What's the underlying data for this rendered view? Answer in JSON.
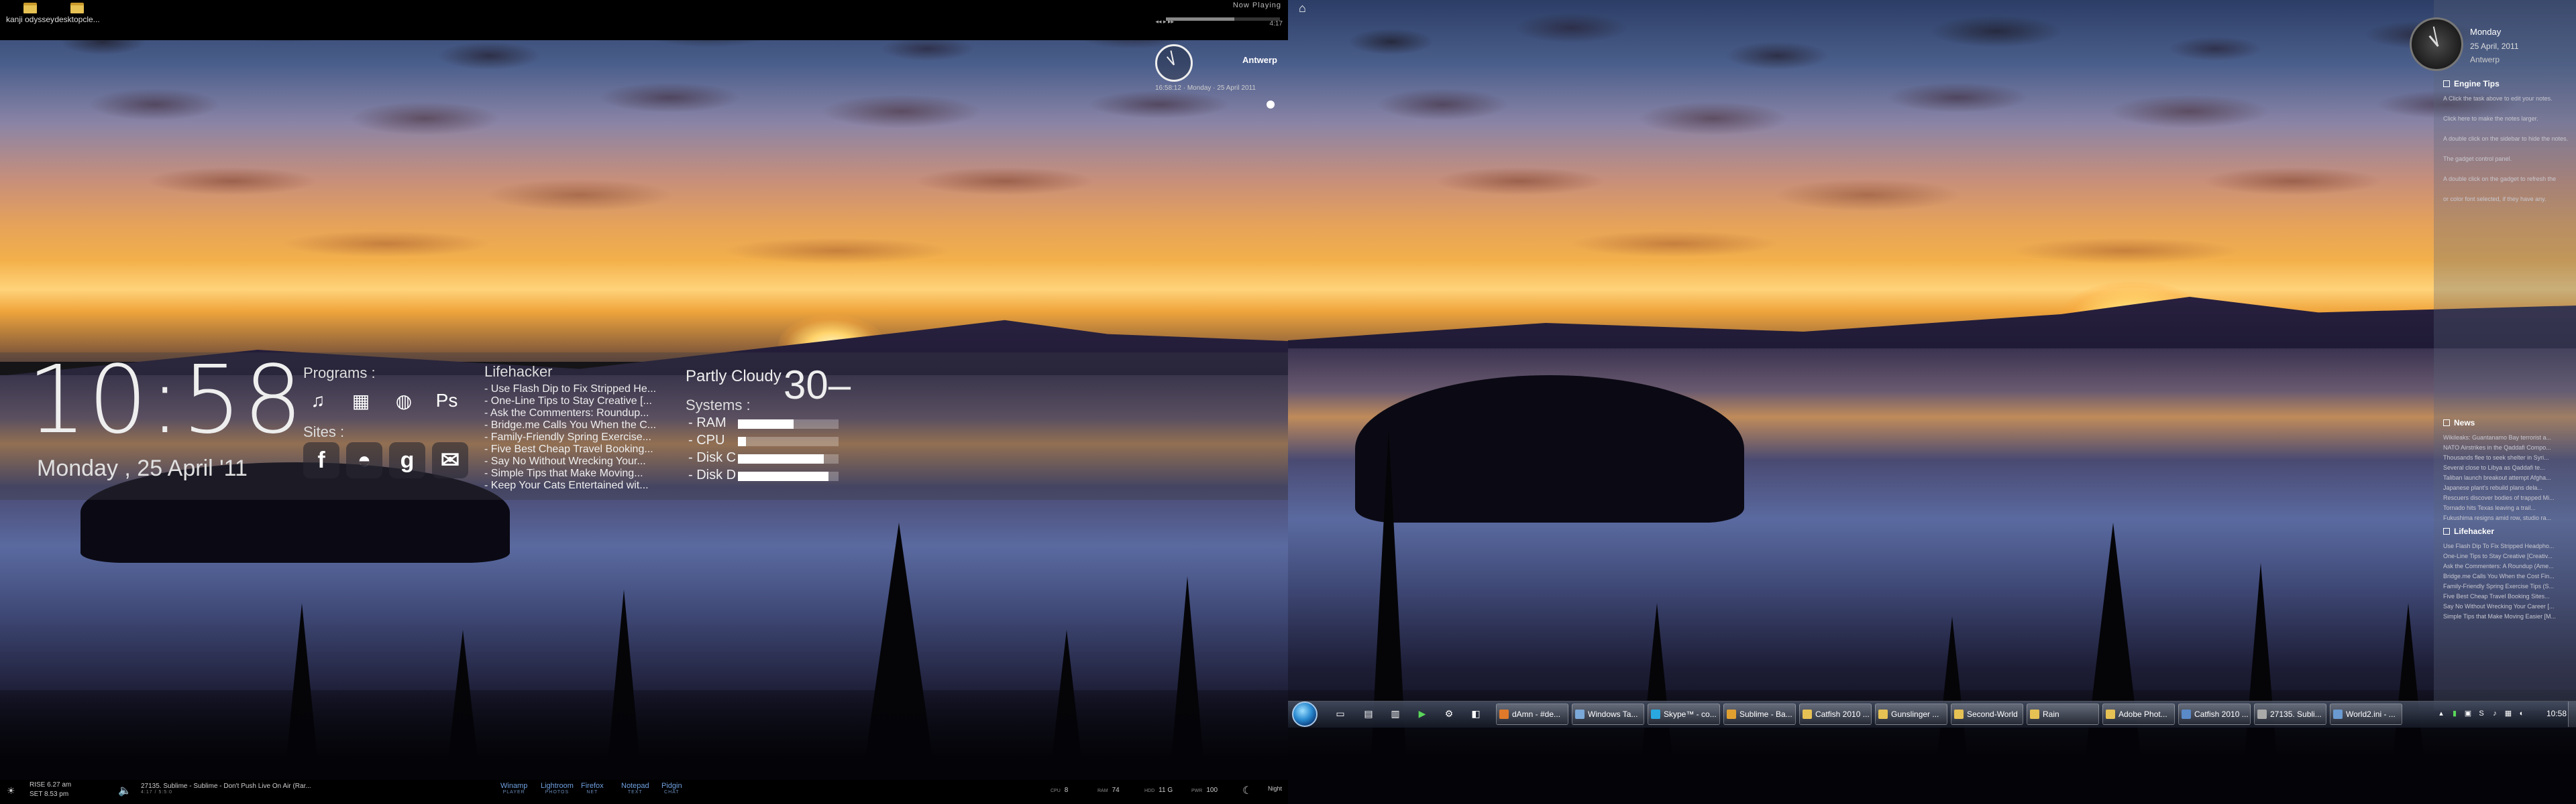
{
  "left_screen": {
    "desktop_icons": [
      {
        "label": "kanji odyssey"
      },
      {
        "label": "desktopcle..."
      }
    ],
    "now_playing": {
      "title": "Now Playing",
      "controls": "◂◂ ▸ ▸▸",
      "time": "4:17",
      "progress_fraction": 0.6
    },
    "clock_city": "Antwerp",
    "weather_mini": "16:58:12  ·  Monday  ·  25 April 2011",
    "main_clock": {
      "time": "10:58",
      "date": "Monday , 25 April '11"
    },
    "programs": {
      "label": "Programs :",
      "icons": [
        {
          "name": "music-icon",
          "glyph": "♫"
        },
        {
          "name": "photos-icon",
          "glyph": "▦"
        },
        {
          "name": "globe-icon",
          "glyph": "◍"
        },
        {
          "name": "photoshop-icon",
          "glyph": "Ps"
        }
      ]
    },
    "sites": {
      "label": "Sites :",
      "icons": [
        {
          "name": "facebook-icon",
          "glyph": "f"
        },
        {
          "name": "lifehacker-icon",
          "glyph": "◓"
        },
        {
          "name": "google-icon",
          "glyph": "g"
        },
        {
          "name": "mail-icon",
          "glyph": "✉"
        }
      ]
    },
    "lifehacker": {
      "title": "Lifehacker",
      "items": [
        "- Use Flash Dip to Fix Stripped He...",
        "- One-Line Tips to Stay Creative [...",
        "- Ask the Commenters: Roundup...",
        "- Bridge.me Calls You When the C...",
        "- Family-Friendly Spring Exercise...",
        "- Five Best Cheap Travel Booking...",
        "- Say No Without Wrecking Your...",
        "- Simple Tips that Make Moving...",
        "- Keep Your Cats Entertained wit..."
      ]
    },
    "weather": {
      "condition": "Partly Cloudy",
      "temperature": "30"
    },
    "systems": {
      "label": "Systems :",
      "rows": [
        {
          "label": "- RAM",
          "fill": 0.55
        },
        {
          "label": "- CPU",
          "fill": 0.08
        },
        {
          "label": "- Disk C",
          "fill": 0.85
        },
        {
          "label": "- Disk D",
          "fill": 0.9
        }
      ]
    },
    "bottom_bar": {
      "sunrise": "RISE 6.27 am",
      "sunset": "SET 8.53 pm",
      "track": "27135. Sublime - Sublime - Don't Push Live On Air (Rar...",
      "track_sub": "4:17 / 5:5:0",
      "launchers": [
        {
          "label": "Winamp",
          "sub": "PLAYER"
        },
        {
          "label": "Lightroom",
          "sub": "PHOTOS"
        },
        {
          "label": "Firefox",
          "sub": "NET"
        },
        {
          "label": "Notepad",
          "sub": "TEXT"
        },
        {
          "label": "Pidgin",
          "sub": "CHAT"
        }
      ],
      "stats": [
        {
          "label": "CPU",
          "value": "8"
        },
        {
          "label": "RAM",
          "value": "74"
        },
        {
          "label": "HDD",
          "value": "11 G"
        },
        {
          "label": "PWR",
          "value": "100"
        }
      ],
      "weather_label": "Night"
    }
  },
  "right_screen": {
    "sidebar": {
      "day": "Monday",
      "date": "25 April, 2011",
      "city": "Antwerp",
      "engine_tips": {
        "title": "Engine Tips",
        "lines": [
          "A Click the task above to edit your notes.",
          "Click here to make the notes larger.",
          "A double click on the sidebar to hide the notes.",
          "The gadget control panel.",
          "A double click on the gadget to refresh the",
          "or color font selected, if they have any."
        ]
      },
      "news": {
        "title": "News",
        "lines": [
          "Wikileaks: Guantanamo Bay terrorist a...",
          "NATO Airstrikes in the Qaddafi Compo...",
          "Thousands flee to seek shelter in Syri...",
          "Several close to Libya as Qaddafi te...",
          "Taliban launch breakout attempt Afgha...",
          "Japanese plant's rebuild plans dela...",
          "Rescuers discover bodies of trapped Mi...",
          "Tornado hits Texas leaving a trail...",
          "Fukushima resigns amid row, studio ra..."
        ]
      },
      "lifehacker": {
        "title": "Lifehacker",
        "lines": [
          "Use Flash Dip To Fix Stripped Headpho...",
          "One-Line Tips to Stay Creative [Creativ...",
          "Ask the Commenters: A Roundup (Ame...",
          "Bridge.me Calls You When the Cost Fin...",
          "Family-Friendly Spring Exercise Tips (S...",
          "Five Best Cheap Travel Booking Sites...",
          "Say No Without Wrecking Your Career [...",
          "Simple Tips that Make Moving Easier [M..."
        ]
      }
    },
    "taskbar": {
      "buttons": [
        {
          "label": "dAmn - #de...",
          "color": "#e07a2a"
        },
        {
          "label": "Windows Ta...",
          "color": "#7aa8d8"
        },
        {
          "label": "Skype™ - co...",
          "color": "#2aa8e0"
        },
        {
          "label": "Sublime - Ba...",
          "color": "#e0a030"
        },
        {
          "label": "Catfish 2010 ...",
          "color": "#e6c154"
        },
        {
          "label": "Gunslinger ...",
          "color": "#e6c154"
        },
        {
          "label": "Second-World",
          "color": "#e6c154"
        },
        {
          "label": "Rain",
          "color": "#e6c154"
        },
        {
          "label": "Adobe Phot...",
          "color": "#e6c154"
        },
        {
          "label": "Catfish 2010 ...",
          "color": "#5a8ac8"
        },
        {
          "label": "27135. Subli...",
          "color": "#aaaaaa"
        },
        {
          "label": "World2.ini - ...",
          "color": "#6a9ad0"
        }
      ],
      "clock": "10:58"
    }
  }
}
